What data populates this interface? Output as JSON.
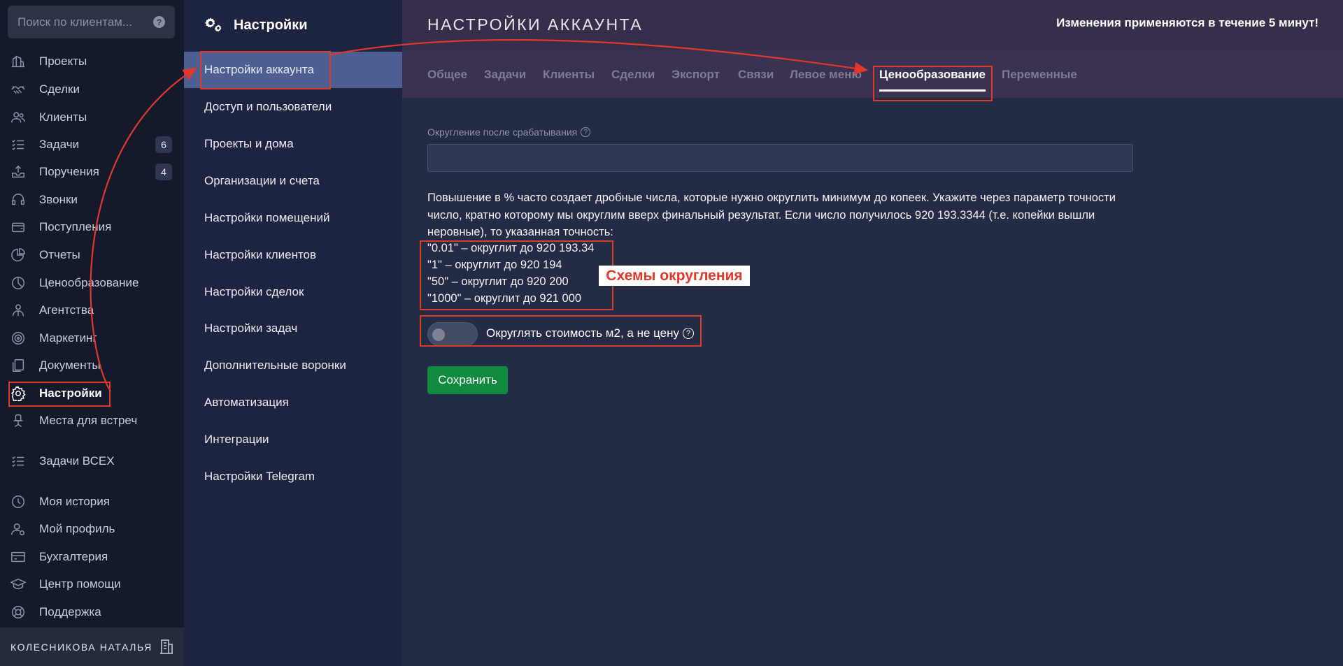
{
  "search": {
    "placeholder": "Поиск по клиентам...",
    "help": "?"
  },
  "nav": {
    "items": [
      {
        "label": "Проекты",
        "icon": "projects-icon"
      },
      {
        "label": "Сделки",
        "icon": "deals-icon"
      },
      {
        "label": "Клиенты",
        "icon": "clients-icon"
      },
      {
        "label": "Задачи",
        "icon": "tasks-icon",
        "badge": "6"
      },
      {
        "label": "Поручения",
        "icon": "assignments-icon",
        "badge": "4"
      },
      {
        "label": "Звонки",
        "icon": "calls-icon"
      },
      {
        "label": "Поступления",
        "icon": "receipts-icon"
      },
      {
        "label": "Отчеты",
        "icon": "reports-icon"
      },
      {
        "label": "Ценообразование",
        "icon": "pricing-icon"
      },
      {
        "label": "Агентства",
        "icon": "agencies-icon"
      },
      {
        "label": "Маркетинг",
        "icon": "marketing-icon"
      },
      {
        "label": "Документы",
        "icon": "documents-icon"
      },
      {
        "label": "Настройки",
        "icon": "gear-icon"
      },
      {
        "label": "Места для встреч",
        "icon": "meeting-places-icon"
      },
      {
        "label": "Задачи ВСЕХ",
        "icon": "all-tasks-icon"
      },
      {
        "label": "Моя история",
        "icon": "history-icon"
      },
      {
        "label": "Мой профиль",
        "icon": "profile-icon"
      },
      {
        "label": "Бухгалтерия",
        "icon": "accounting-icon"
      },
      {
        "label": "Центр помощи",
        "icon": "help-center-icon"
      },
      {
        "label": "Поддержка",
        "icon": "support-icon"
      }
    ],
    "user_name": "КОЛЕСНИКОВА НАТАЛЬЯ"
  },
  "settings_menu": {
    "title": "Настройки",
    "items": [
      "Настройки аккаунта",
      "Доступ и пользователи",
      "Проекты и дома",
      "Организации и счета",
      "Настройки помещений",
      "Настройки клиентов",
      "Настройки сделок",
      "Настройки задач",
      "Дополнительные воронки",
      "Автоматизация",
      "Интеграции",
      "Настройки Telegram"
    ]
  },
  "header": {
    "title": "НАСТРОЙКИ АККАУНТА",
    "notice": "Изменения применяются в течение 5 минут!"
  },
  "tabs": [
    "Общее",
    "Задачи",
    "Клиенты",
    "Сделки",
    "Экспорт",
    "Связи",
    "Левое меню",
    "Ценообразование",
    "Переменные"
  ],
  "pricing": {
    "field_label": "Округление после срабатывания",
    "field_value": "",
    "description": "Повышение в % часто создает дробные числа, которые нужно округлить минимум до копеек. Укажите через параметр точности число, кратно которому мы округлим вверх финальный результат. Если число получилось 920 193.3344 (т.е. копейки вышли неровные), то указанная точность:",
    "examples": [
      "\"0.01\" – округлит до 920 193.34",
      "\"1\" – округлит до 920 194",
      "\"50\" – округлит до 920 200",
      "\"1000\" – округлит до 921 000"
    ],
    "toggle_label": "Округлять стоимость м2, а не цену",
    "toggle_on": false,
    "save_label": "Сохранить"
  },
  "annotation": {
    "label": "Схемы округления",
    "color": "#e0392a"
  }
}
